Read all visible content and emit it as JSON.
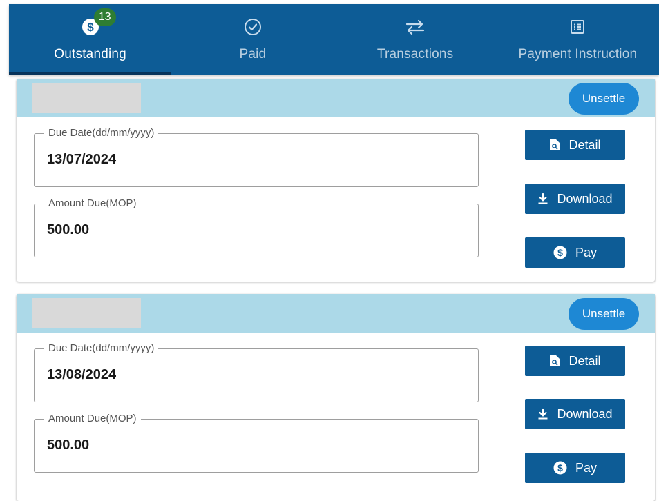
{
  "tabs": [
    {
      "label": "Outstanding",
      "icon": "dollar-circle-icon",
      "badge": "13",
      "active": true
    },
    {
      "label": "Paid",
      "icon": "check-circle-icon",
      "active": false
    },
    {
      "label": "Transactions",
      "icon": "swap-arrows-icon",
      "active": false
    },
    {
      "label": "Payment Instruction",
      "icon": "list-document-icon",
      "active": false
    }
  ],
  "bills": [
    {
      "unsettle_label": "Unsettle",
      "due_date_label": "Due Date(dd/mm/yyyy)",
      "due_date": "13/07/2024",
      "amount_label": "Amount Due(MOP)",
      "amount": "500.00",
      "detail_label": "Detail",
      "download_label": "Download",
      "pay_label": "Pay"
    },
    {
      "unsettle_label": "Unsettle",
      "due_date_label": "Due Date(dd/mm/yyyy)",
      "due_date": "13/08/2024",
      "amount_label": "Amount Due(MOP)",
      "amount": "500.00",
      "detail_label": "Detail",
      "download_label": "Download",
      "pay_label": "Pay"
    }
  ],
  "colors": {
    "tabbar": "#0d5c96",
    "card_header": "#acd9e8",
    "unsettle": "#1e88d4",
    "badge": "#2e7d32",
    "button": "#0d5c96"
  }
}
